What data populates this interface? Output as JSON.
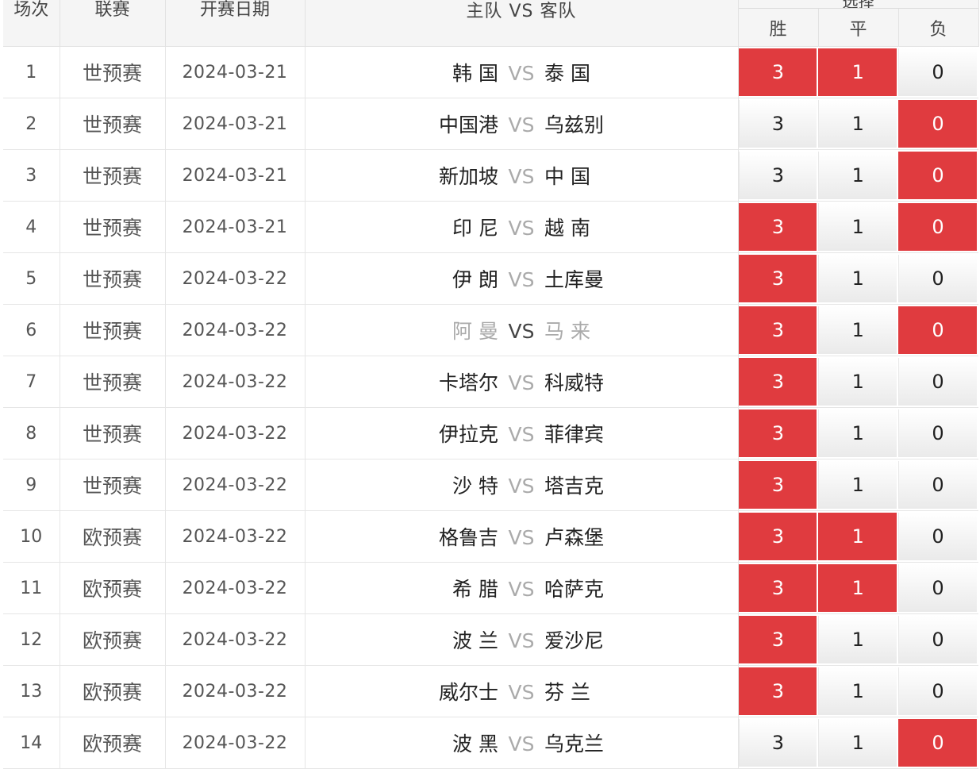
{
  "headers": {
    "index": "场次",
    "league": "联赛",
    "date": "开赛日期",
    "home": "主队",
    "vs": "VS",
    "away": "客队",
    "result_group": "选择",
    "win": "胜",
    "draw": "平",
    "lose": "负"
  },
  "colors": {
    "selected": "#e03b3f",
    "vs_text": "#aaaaaa",
    "muted_team": "#aaaaaa"
  },
  "rows": [
    {
      "idx": "1",
      "league": "世预赛",
      "date": "2024-03-21",
      "home": "韩 国",
      "away": "泰 国",
      "win": "3",
      "draw": "1",
      "lose": "0",
      "win_on": true,
      "draw_on": true,
      "lose_on": false,
      "muted": false
    },
    {
      "idx": "2",
      "league": "世预赛",
      "date": "2024-03-21",
      "home": "中国港",
      "away": "乌兹别",
      "win": "3",
      "draw": "1",
      "lose": "0",
      "win_on": false,
      "draw_on": false,
      "lose_on": true,
      "muted": false
    },
    {
      "idx": "3",
      "league": "世预赛",
      "date": "2024-03-21",
      "home": "新加坡",
      "away": "中 国",
      "win": "3",
      "draw": "1",
      "lose": "0",
      "win_on": false,
      "draw_on": false,
      "lose_on": true,
      "muted": false
    },
    {
      "idx": "4",
      "league": "世预赛",
      "date": "2024-03-21",
      "home": "印 尼",
      "away": "越 南",
      "win": "3",
      "draw": "1",
      "lose": "0",
      "win_on": true,
      "draw_on": false,
      "lose_on": true,
      "muted": false
    },
    {
      "idx": "5",
      "league": "世预赛",
      "date": "2024-03-22",
      "home": "伊 朗",
      "away": "土库曼",
      "win": "3",
      "draw": "1",
      "lose": "0",
      "win_on": true,
      "draw_on": false,
      "lose_on": false,
      "muted": false
    },
    {
      "idx": "6",
      "league": "世预赛",
      "date": "2024-03-22",
      "home": "阿 曼",
      "away": "马 来",
      "win": "3",
      "draw": "1",
      "lose": "0",
      "win_on": true,
      "draw_on": false,
      "lose_on": true,
      "muted": true
    },
    {
      "idx": "7",
      "league": "世预赛",
      "date": "2024-03-22",
      "home": "卡塔尔",
      "away": "科威特",
      "win": "3",
      "draw": "1",
      "lose": "0",
      "win_on": true,
      "draw_on": false,
      "lose_on": false,
      "muted": false
    },
    {
      "idx": "8",
      "league": "世预赛",
      "date": "2024-03-22",
      "home": "伊拉克",
      "away": "菲律宾",
      "win": "3",
      "draw": "1",
      "lose": "0",
      "win_on": true,
      "draw_on": false,
      "lose_on": false,
      "muted": false
    },
    {
      "idx": "9",
      "league": "世预赛",
      "date": "2024-03-22",
      "home": "沙 特",
      "away": "塔吉克",
      "win": "3",
      "draw": "1",
      "lose": "0",
      "win_on": true,
      "draw_on": false,
      "lose_on": false,
      "muted": false
    },
    {
      "idx": "10",
      "league": "欧预赛",
      "date": "2024-03-22",
      "home": "格鲁吉",
      "away": "卢森堡",
      "win": "3",
      "draw": "1",
      "lose": "0",
      "win_on": true,
      "draw_on": true,
      "lose_on": false,
      "muted": false
    },
    {
      "idx": "11",
      "league": "欧预赛",
      "date": "2024-03-22",
      "home": "希 腊",
      "away": "哈萨克",
      "win": "3",
      "draw": "1",
      "lose": "0",
      "win_on": true,
      "draw_on": true,
      "lose_on": false,
      "muted": false
    },
    {
      "idx": "12",
      "league": "欧预赛",
      "date": "2024-03-22",
      "home": "波 兰",
      "away": "爱沙尼",
      "win": "3",
      "draw": "1",
      "lose": "0",
      "win_on": true,
      "draw_on": false,
      "lose_on": false,
      "muted": false
    },
    {
      "idx": "13",
      "league": "欧预赛",
      "date": "2024-03-22",
      "home": "威尔士",
      "away": "芬 兰",
      "win": "3",
      "draw": "1",
      "lose": "0",
      "win_on": true,
      "draw_on": false,
      "lose_on": false,
      "muted": false
    },
    {
      "idx": "14",
      "league": "欧预赛",
      "date": "2024-03-22",
      "home": "波 黑",
      "away": "乌克兰",
      "win": "3",
      "draw": "1",
      "lose": "0",
      "win_on": false,
      "draw_on": false,
      "lose_on": true,
      "muted": false
    }
  ]
}
